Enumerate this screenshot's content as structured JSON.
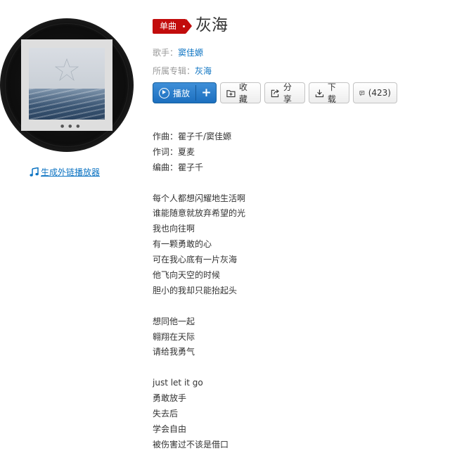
{
  "left": {
    "ext_player_label": "生成外链播放器",
    "ext_player_icon": "music-note-icon",
    "cover_icon": "album-cover-image"
  },
  "song": {
    "badge": "单曲",
    "title": "灰海",
    "singer_label": "歌手：",
    "singer": "窦佳嫄",
    "album_label": "所属专辑：",
    "album": "灰海"
  },
  "buttons": {
    "play": "播放",
    "add": "+",
    "collect": "收藏",
    "share": "分享",
    "download": "下载",
    "comment": "(423)"
  },
  "colors": {
    "accent_red": "#c20c0c",
    "link_blue": "#0c73c2",
    "play_blue": "#2b7fd0"
  },
  "lyrics": [
    "作曲：瞿子千/窦佳嫄",
    "作词：夏麦",
    "编曲：瞿子千",
    "",
    "每个人都想闪耀地生活啊",
    "谁能随意就放弃希望的光",
    "我也向往啊",
    "有一颗勇敢的心",
    "可在我心底有一片灰海",
    "他飞向天空的时候",
    "胆小的我却只能抬起头",
    "",
    "想同他一起",
    "翱翔在天际",
    "请给我勇气",
    "",
    "just let it go",
    "勇敢放手",
    "失去后",
    "学会自由",
    "被伤害过不该是借口"
  ]
}
